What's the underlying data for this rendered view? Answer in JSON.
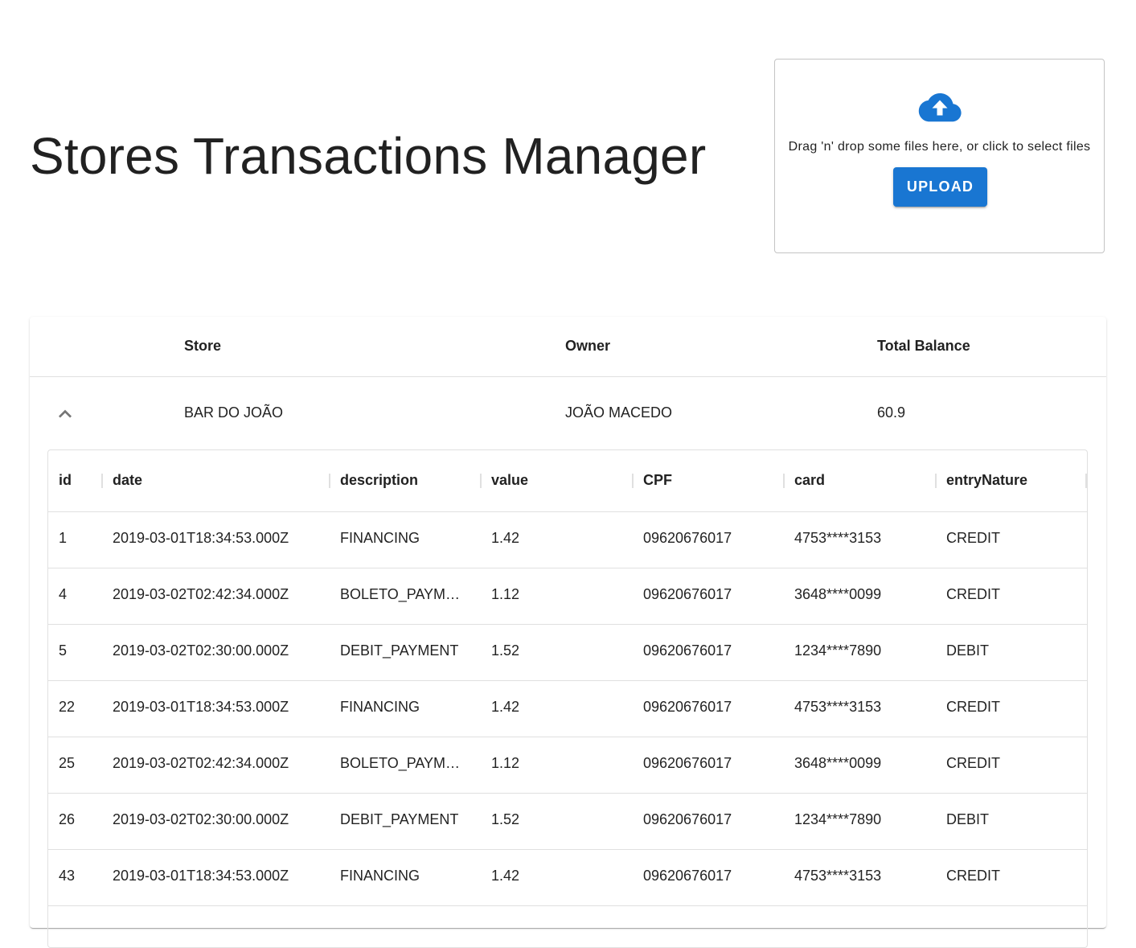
{
  "header": {
    "title": "Stores Transactions Manager"
  },
  "dropzone": {
    "icon": "cloud-upload-icon",
    "text": "Drag 'n' drop some files here, or click to select files",
    "button_label": "UPLOAD",
    "accent_color": "#1976d2"
  },
  "stores_table": {
    "columns": [
      "Store",
      "Owner",
      "Total Balance"
    ],
    "rows": [
      {
        "expanded": true,
        "toggle_icon": "chevron-up-icon",
        "store": "BAR DO JOÃO",
        "owner": "JOÃO MACEDO",
        "total_balance": "60.9"
      }
    ]
  },
  "transactions_grid": {
    "columns": [
      "id",
      "date",
      "description",
      "value",
      "CPF",
      "card",
      "entryNature"
    ],
    "rows": [
      {
        "id": "1",
        "date": "2019-03-01T18:34:53.000Z",
        "description": "FINANCING",
        "value": "1.42",
        "cpf": "09620676017",
        "card": "4753****3153",
        "entryNature": "CREDIT"
      },
      {
        "id": "4",
        "date": "2019-03-02T02:42:34.000Z",
        "description": "BOLETO_PAYME…",
        "value": "1.12",
        "cpf": "09620676017",
        "card": "3648****0099",
        "entryNature": "CREDIT"
      },
      {
        "id": "5",
        "date": "2019-03-02T02:30:00.000Z",
        "description": "DEBIT_PAYMENT",
        "value": "1.52",
        "cpf": "09620676017",
        "card": "1234****7890",
        "entryNature": "DEBIT"
      },
      {
        "id": "22",
        "date": "2019-03-01T18:34:53.000Z",
        "description": "FINANCING",
        "value": "1.42",
        "cpf": "09620676017",
        "card": "4753****3153",
        "entryNature": "CREDIT"
      },
      {
        "id": "25",
        "date": "2019-03-02T02:42:34.000Z",
        "description": "BOLETO_PAYME…",
        "value": "1.12",
        "cpf": "09620676017",
        "card": "3648****0099",
        "entryNature": "CREDIT"
      },
      {
        "id": "26",
        "date": "2019-03-02T02:30:00.000Z",
        "description": "DEBIT_PAYMENT",
        "value": "1.52",
        "cpf": "09620676017",
        "card": "1234****7890",
        "entryNature": "DEBIT"
      },
      {
        "id": "43",
        "date": "2019-03-01T18:34:53.000Z",
        "description": "FINANCING",
        "value": "1.42",
        "cpf": "09620676017",
        "card": "4753****3153",
        "entryNature": "CREDIT"
      }
    ]
  }
}
